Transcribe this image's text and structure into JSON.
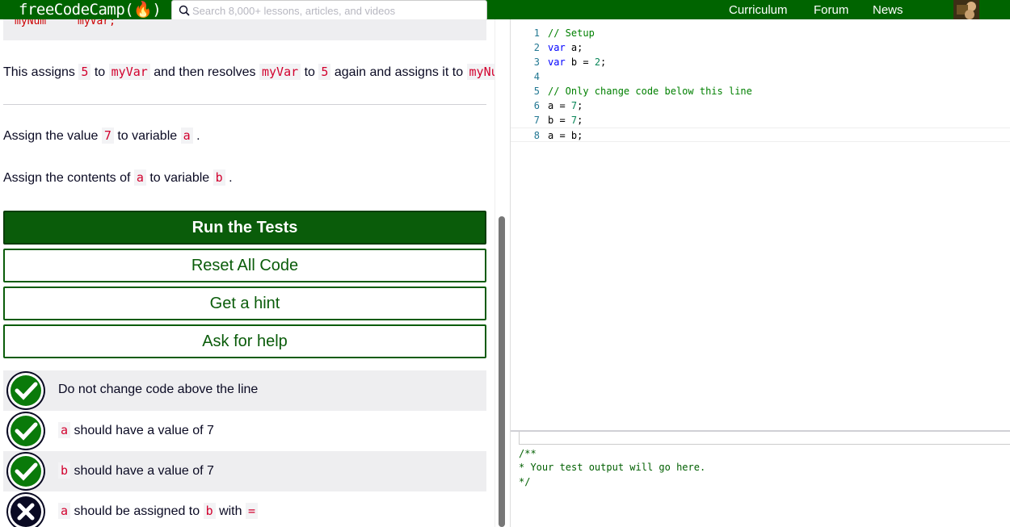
{
  "navbar": {
    "logo": "freeCodeCamp(🔥)",
    "search_placeholder": "Search 8,000+ lessons, articles, and videos",
    "links": [
      "Curriculum",
      "Forum",
      "News"
    ]
  },
  "lesson": {
    "code_peek": [
      "myNum",
      "myVar;"
    ],
    "para1": {
      "t1": "This assigns ",
      "c1": "5",
      "t2": " to ",
      "c2": "myVar",
      "t3": " and then resolves ",
      "c3": "myVar",
      "t4": " to ",
      "c4": "5",
      "t5": " again and assigns it to ",
      "c5": "myNum",
      "t6": " ."
    },
    "instr1": {
      "t1": "Assign the value ",
      "c1": "7",
      "t2": " to variable ",
      "c2": "a",
      "t3": " ."
    },
    "instr2": {
      "t1": "Assign the contents of ",
      "c1": "a",
      "t2": " to variable ",
      "c2": "b",
      "t3": " ."
    }
  },
  "buttons": {
    "run": "Run the Tests",
    "reset": "Reset All Code",
    "hint": "Get a hint",
    "help": "Ask for help"
  },
  "tests": [
    {
      "pre": "",
      "code": "",
      "text": "Do not change code above the line",
      "code2": "",
      "status": "pass"
    },
    {
      "pre": "",
      "code": "a",
      "text": " should have a value of 7",
      "code2": "",
      "status": "pass"
    },
    {
      "pre": "",
      "code": "b",
      "text": " should have a value of 7",
      "code2": "",
      "status": "pass"
    },
    {
      "pre": "",
      "code": "a",
      "text": " should be assigned to ",
      "code2": "b",
      "text2": " with ",
      "code3": "=",
      "status": "fail"
    }
  ],
  "editor": {
    "lines": [
      {
        "n": "1",
        "html": "// Setup"
      },
      {
        "n": "2",
        "html": "var a;"
      },
      {
        "n": "3",
        "html": "var b = 2;"
      },
      {
        "n": "4",
        "html": ""
      },
      {
        "n": "5",
        "html": "// Only change code below this line"
      },
      {
        "n": "6",
        "html": "a = 7;"
      },
      {
        "n": "7",
        "html": "b = 7;"
      },
      {
        "n": "8",
        "html": "a = b;"
      }
    ]
  },
  "output": {
    "lines": [
      "/**",
      "* Your test output will go here.",
      "*/"
    ]
  },
  "colors": {
    "nav_bg": "#006400",
    "button_green": "#0a5c0a",
    "pass_bg": "#0a7a0a",
    "fail_bg": "#0a0a23",
    "code_red": "#d2002d"
  }
}
